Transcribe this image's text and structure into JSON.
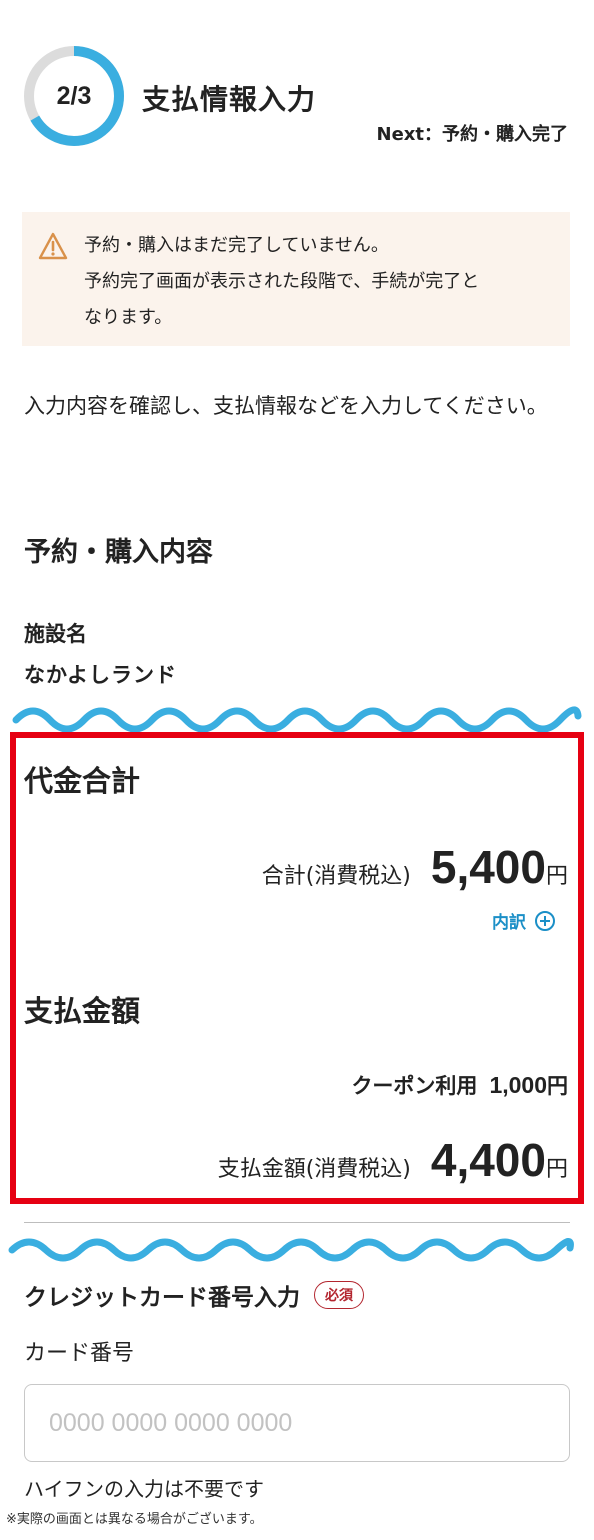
{
  "header": {
    "progress_text": "2/3",
    "progress_fraction": 0.667,
    "step_title": "支払情報入力",
    "next_step": "Next：予約・購入完了"
  },
  "notice": {
    "icon": "warning-icon",
    "lines": [
      "予約・購入はまだ完了していません。",
      "予約完了画面が表示された段階で、手続が完了と",
      "なります。"
    ]
  },
  "instruction": "入力内容を確認し、支払情報などを入力してください。",
  "reservation": {
    "section_title": "予約・購入内容",
    "facility_label": "施設名",
    "facility_value": "なかよしランド"
  },
  "price": {
    "subtotal_heading": "代金合計",
    "total_label": "合計(消費税込)",
    "total_amount": "5,400",
    "yen": "円",
    "breakdown_label": "内訳",
    "breakdown_icon": "plus-circle-icon",
    "payment_heading": "支払金額",
    "coupon_label": "クーポン利用",
    "coupon_amount": "1,000",
    "payment_label": "支払金額(消費税込)",
    "payment_amount": "4,400"
  },
  "card": {
    "section_title": "クレジットカード番号入力",
    "required_badge": "必須",
    "card_label": "カード番号",
    "card_placeholder": "0000 0000 0000 0000",
    "card_value": "",
    "hyphen_note": "ハイフンの入力は不要です"
  },
  "disclaimer": "※実際の画面とは異なる場合がございます。",
  "colors": {
    "accent_blue": "#3aaee0",
    "link_blue": "#1b8fc7",
    "highlight_red": "#e60012",
    "notice_bg": "#fbf3ec",
    "warning_orange": "#d9914a",
    "required_red": "#b3262f"
  }
}
